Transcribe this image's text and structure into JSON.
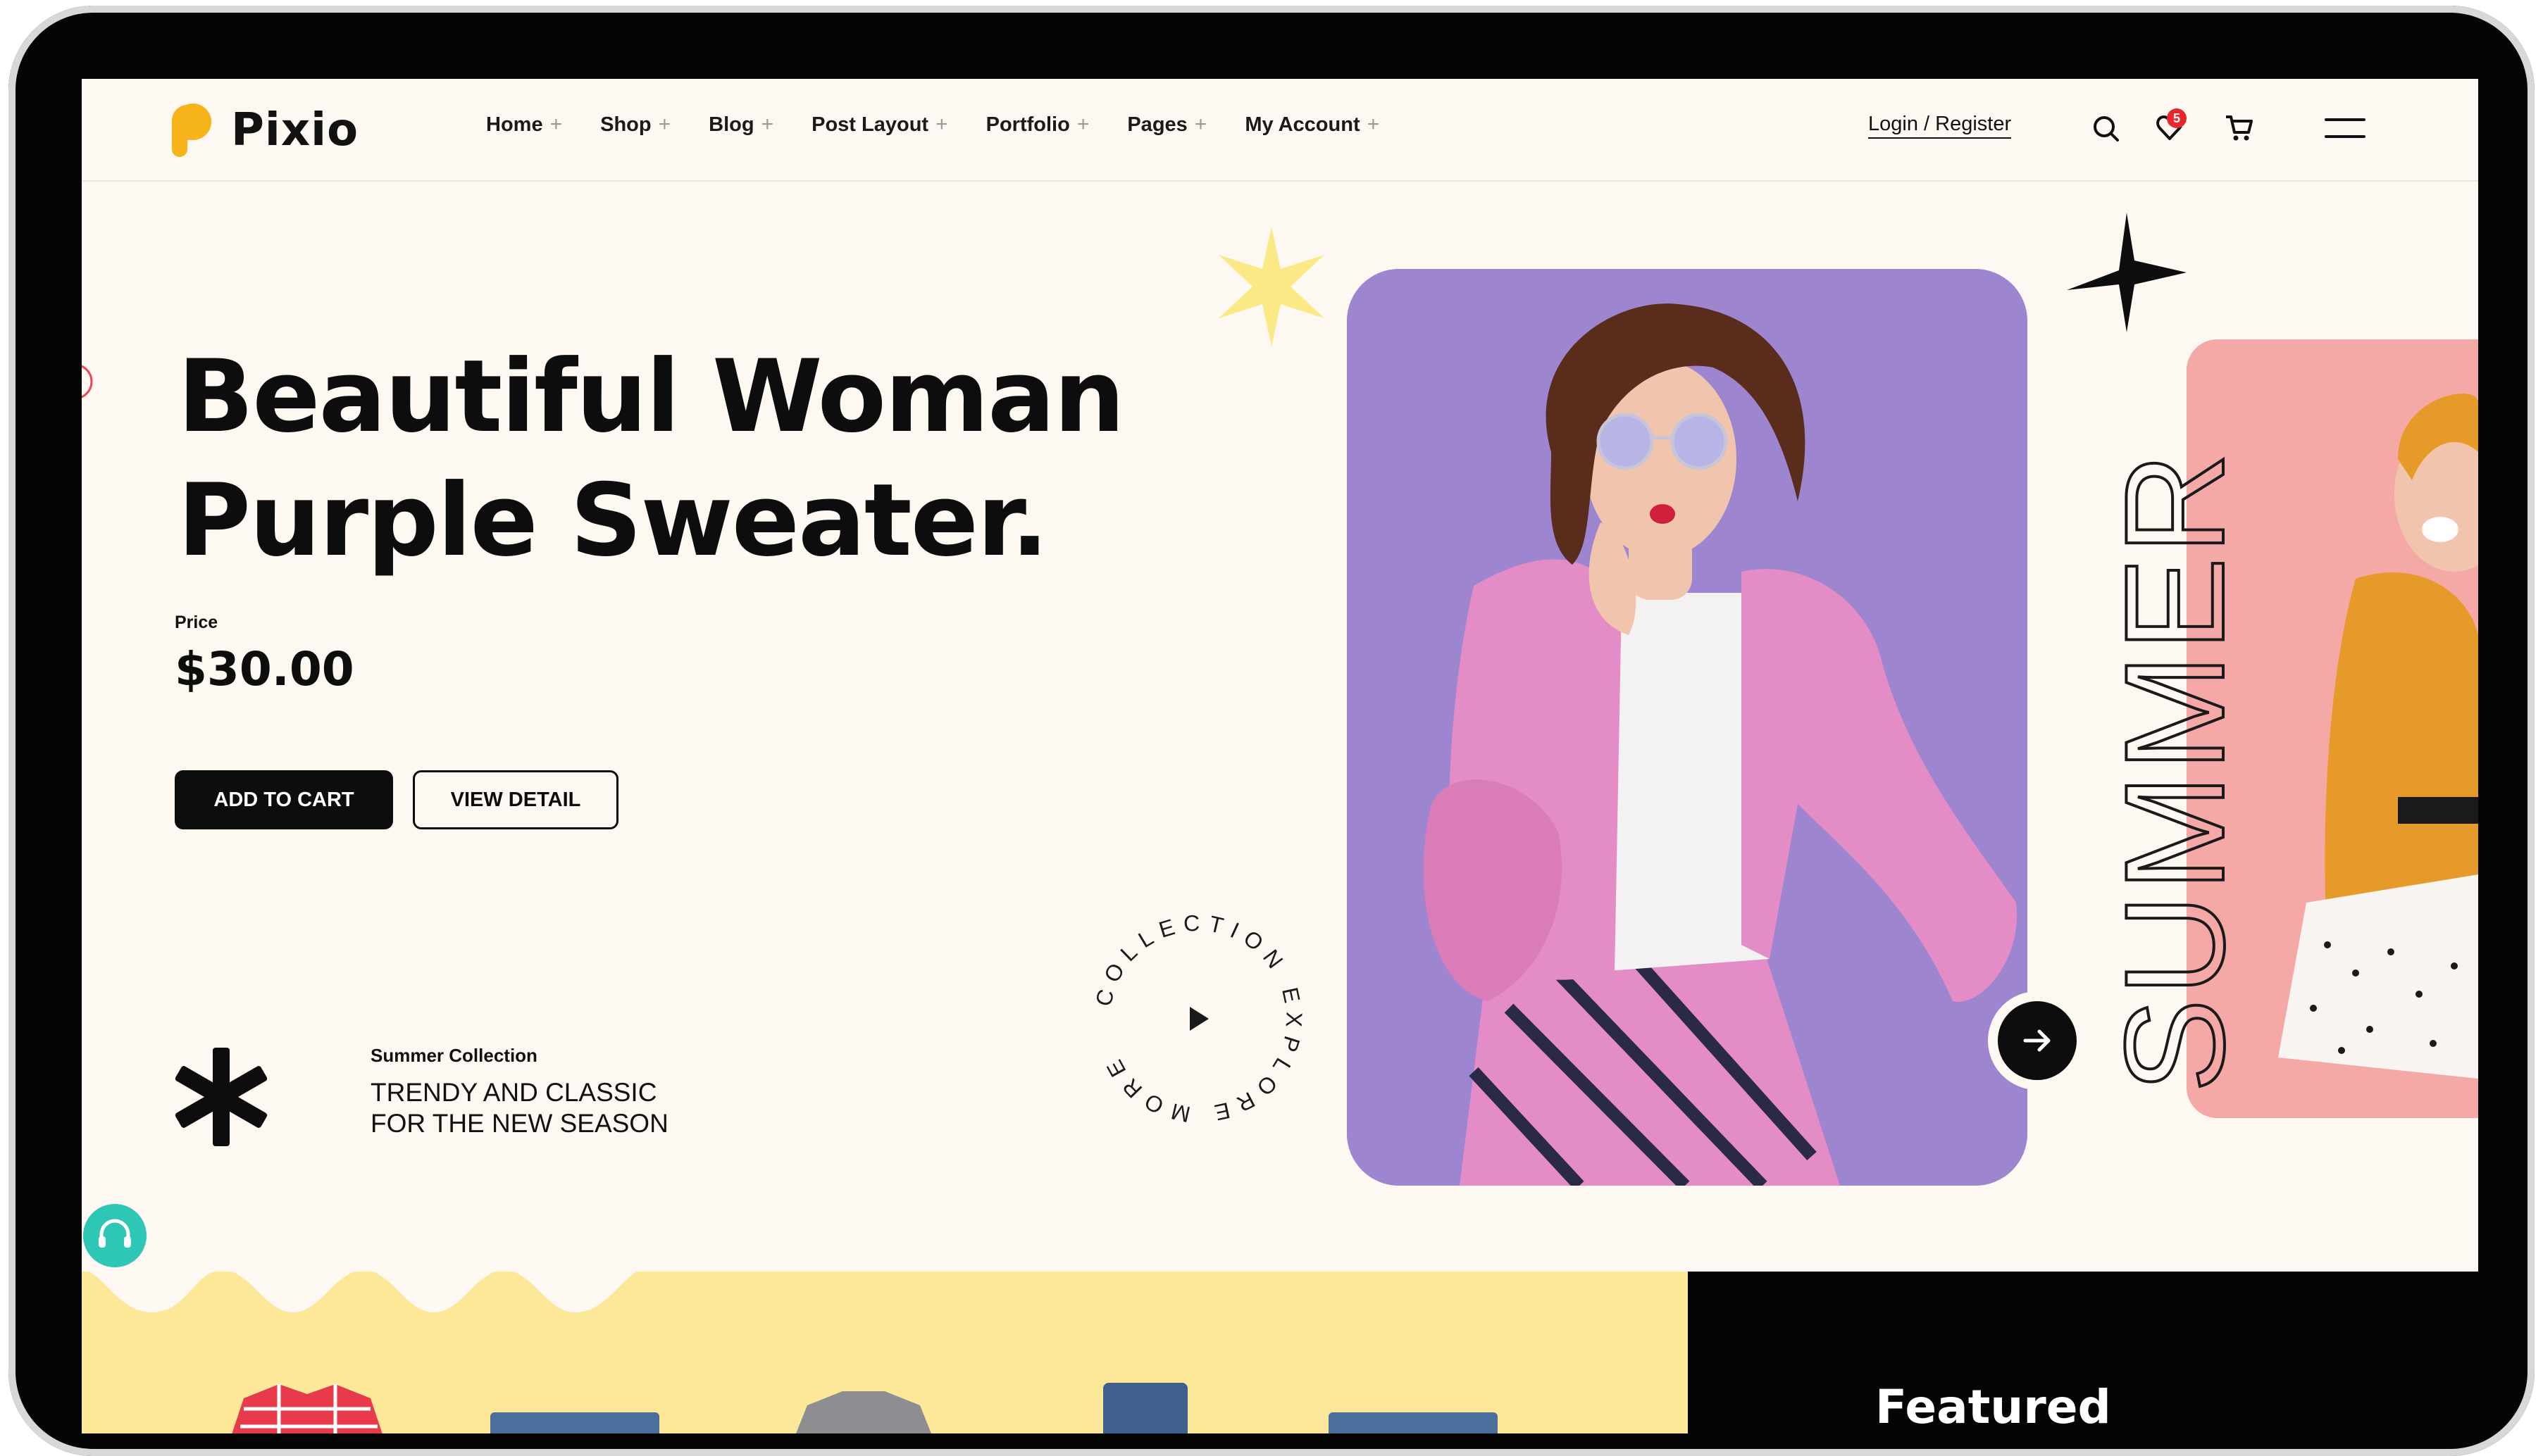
{
  "brand": {
    "name": "Pixio",
    "accent": "#f7b41a"
  },
  "nav": {
    "items": [
      {
        "label": "Home"
      },
      {
        "label": "Shop"
      },
      {
        "label": "Blog"
      },
      {
        "label": "Post Layout"
      },
      {
        "label": "Portfolio"
      },
      {
        "label": "Pages"
      },
      {
        "label": "My Account"
      }
    ],
    "login_label": "Login / Register",
    "cart_count": "5"
  },
  "hero": {
    "title_line1": "Beautiful Woman",
    "title_line2": "Purple Sweater.",
    "price_label": "Price",
    "price": "$30.00",
    "add_to_cart": "ADD TO CART",
    "view_detail": "VIEW DETAIL",
    "explore_text": "COLLECTION EXPLORE MORE",
    "side_word": "SUMMER"
  },
  "collection": {
    "label": "Summer Collection",
    "line1": "TRENDY AND CLASSIC",
    "line2": "FOR THE NEW SEASON"
  },
  "featured": {
    "title": "Featured"
  },
  "colors": {
    "background": "#fdf8f1",
    "primary": "#0d0d0d",
    "main_photo_bg": "#9d86cf",
    "side_photo_bg": "#f5a9a6",
    "bottom_yellow": "#fde89a",
    "badge": "#e8262b",
    "support": "#2ec6b4"
  }
}
